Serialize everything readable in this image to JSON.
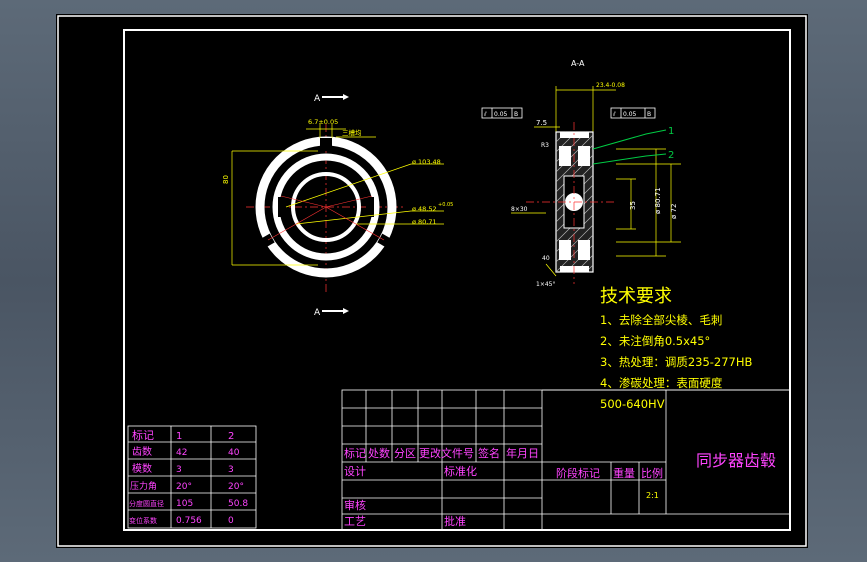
{
  "section": {
    "title": "A-A",
    "marker_label": "A",
    "dims": {
      "width_top": "23.4-0.08",
      "chamfer_l": "7.5",
      "bore_w": "8×30",
      "tol_a": "0.05",
      "tol_b": "0.05",
      "ref": "B",
      "d_inner": "35",
      "d_72": "ø 72",
      "d_outer": "ø 80.71",
      "ch_45": "1×45°",
      "cb": "R3",
      "len_2": "40"
    },
    "callouts": [
      "1",
      "2"
    ]
  },
  "front_view": {
    "dims": {
      "d_top": "6.7±0.05",
      "tri": "三槽均",
      "d1": "ø 103.48",
      "d2": "ø 48.52",
      "d3": "ø 80.71",
      "tol": "+0.05",
      "side": "80"
    }
  },
  "requirements": {
    "title": "技术要求",
    "items": [
      "1、去除全部尖棱、毛刺",
      "2、未注倒角0.5x45°",
      "3、热处理：调质235-277HB",
      "4、渗碳处理：表面硬度",
      "500-640HV"
    ]
  },
  "gear_table": {
    "header": [
      "标记",
      "1",
      "2"
    ],
    "rows": [
      [
        "齿数",
        "42",
        "40"
      ],
      [
        "模数",
        "3",
        "3"
      ],
      [
        "压力角",
        "20°",
        "20°"
      ],
      [
        "分度圆直径",
        "105",
        "50.8"
      ],
      [
        "变位系数",
        "0.756",
        "0"
      ]
    ]
  },
  "title_block": {
    "labels": [
      "标记",
      "处数",
      "分区",
      "更改文件号",
      "签名",
      "年月日"
    ],
    "design": "设计",
    "standard": "标准化",
    "review": "审核",
    "process": "工艺",
    "approve": "批准",
    "stage": "阶段标记",
    "weight": "重量",
    "scale": "比例",
    "scale_val": "2:1",
    "part_name": "同步器齿毂"
  },
  "colors": {
    "paper": "#000000",
    "line": "#ffffff",
    "dim": "#ffff00",
    "text_magenta": "#ff44ff",
    "hatch": "#bbbbbb",
    "leader": "#00cc44",
    "center": "#ff3333"
  }
}
